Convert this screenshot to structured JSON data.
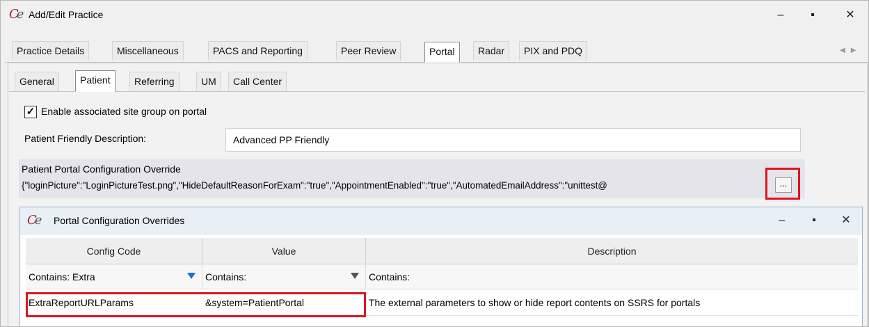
{
  "window": {
    "title": "Add/Edit Practice",
    "controls": {
      "minimize": "–",
      "maximize": "▪",
      "close": "✕"
    }
  },
  "main_tabs": [
    {
      "label": "Practice Details",
      "active": false
    },
    {
      "label": "Miscellaneous",
      "active": false
    },
    {
      "label": "PACS and Reporting",
      "active": false
    },
    {
      "label": "Peer Review",
      "active": false
    },
    {
      "label": "Portal",
      "active": true
    },
    {
      "label": "Radar",
      "active": false
    },
    {
      "label": "PIX and PDQ",
      "active": false
    }
  ],
  "sub_tabs": [
    {
      "label": "General",
      "active": false
    },
    {
      "label": "Patient",
      "active": true
    },
    {
      "label": "Referring",
      "active": false
    },
    {
      "label": "UM",
      "active": false
    },
    {
      "label": "Call Center",
      "active": false
    }
  ],
  "patient": {
    "enable_checkbox_label": "Enable associated site group on portal",
    "enable_checked": true,
    "friendly_label": "Patient Friendly Description:",
    "friendly_value": "Advanced PP Friendly",
    "override_label": "Patient Portal Configuration Override",
    "override_value": "{\"loginPicture\":\"LoginPictureTest.png\",\"HideDefaultReasonForExam\":\"true\",\"AppointmentEnabled\":\"true\",\"AutomatedEmailAddress\":\"unittest@",
    "ellipsis_label": "..."
  },
  "dialog": {
    "title": "Portal Configuration Overrides",
    "columns": [
      "Config Code",
      "Value",
      "Description"
    ],
    "filters": [
      "Contains: Extra",
      "Contains:",
      "Contains:"
    ],
    "rows": [
      {
        "config_code": "ExtraReportURLParams",
        "value": "&system=PatientPortal",
        "description": "The external parameters to show or hide report contents on SSRS for portals"
      }
    ]
  },
  "colors": {
    "highlight": "#e0141e",
    "active_filter_icon": "#1a73c8",
    "inactive_filter_icon": "#555555"
  }
}
